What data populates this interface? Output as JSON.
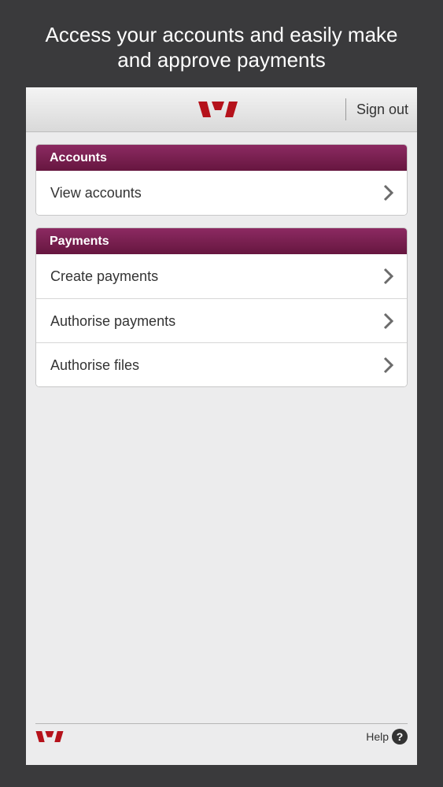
{
  "headline": {
    "line1": "Access your accounts and easily make",
    "line2": "and approve payments"
  },
  "topbar": {
    "logo": "westpac-logo",
    "sign_out_label": "Sign out"
  },
  "accounts_section": {
    "title": "Accounts",
    "items": [
      {
        "label": "View accounts"
      }
    ]
  },
  "payments_section": {
    "title": "Payments",
    "items": [
      {
        "label": "Create payments"
      },
      {
        "label": "Authorise payments"
      },
      {
        "label": "Authorise files"
      }
    ]
  },
  "footer": {
    "logo": "westpac-logo",
    "help_label": "Help",
    "help_icon": "?"
  },
  "colors": {
    "brand": "#b5121b",
    "section_header": "#7a1f52",
    "background": "#3a3a3c"
  }
}
